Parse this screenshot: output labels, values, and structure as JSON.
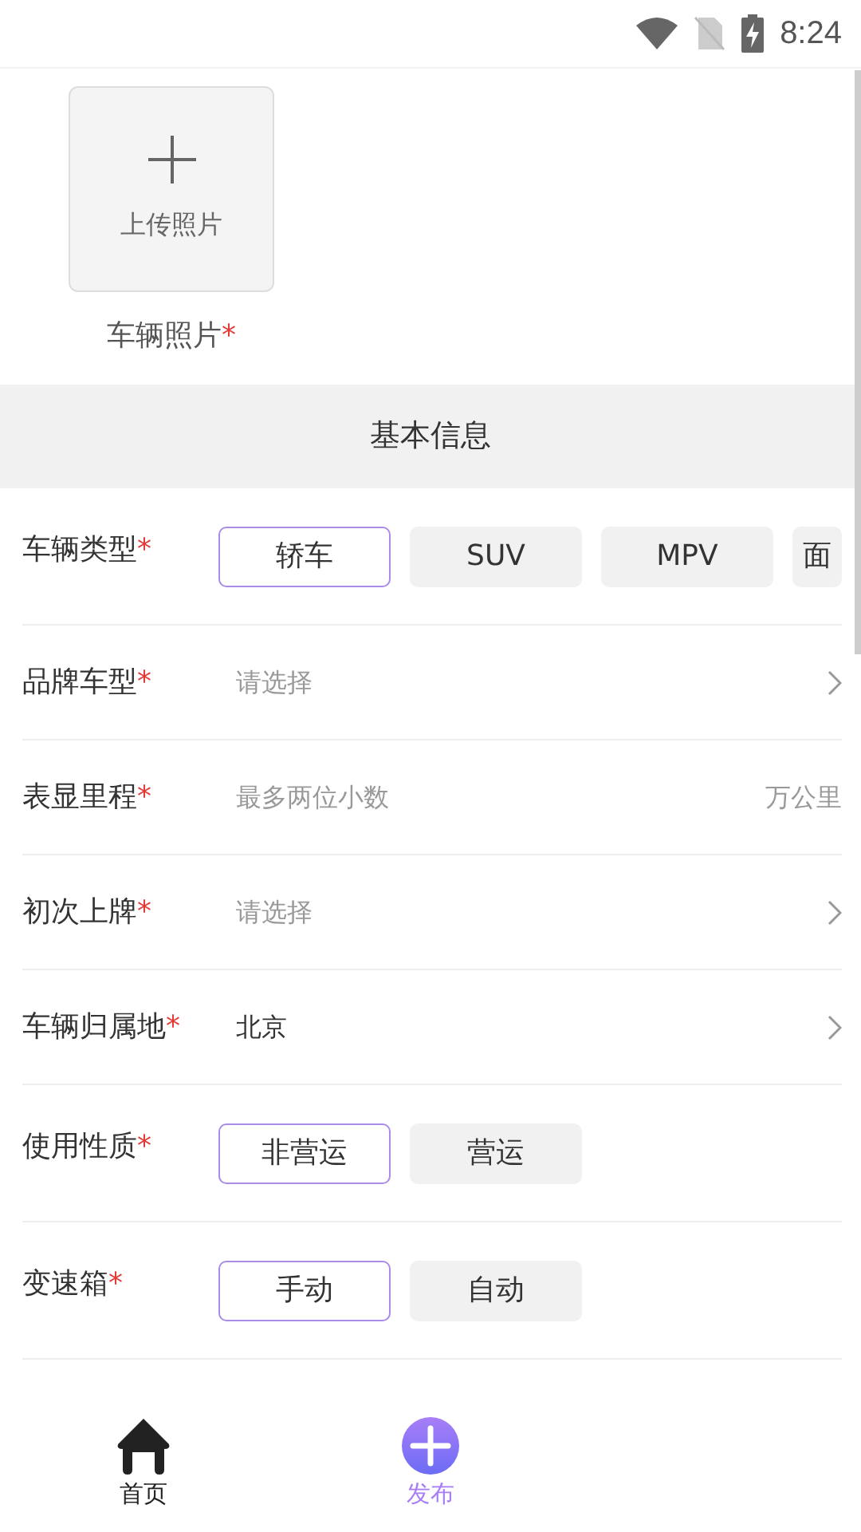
{
  "status_bar": {
    "time": "8:24"
  },
  "photo_upload": {
    "button_label": "上传照片",
    "caption": "车辆照片",
    "required_mark": "*"
  },
  "section_header": {
    "title": "基本信息"
  },
  "fields": [
    {
      "kind": "chips",
      "label": "车辆类型",
      "required_mark": "*",
      "options": [
        {
          "label": "轿车",
          "selected": true
        },
        {
          "label": "SUV",
          "selected": false
        },
        {
          "label": "MPV",
          "selected": false
        },
        {
          "label": "面",
          "selected": false
        }
      ]
    },
    {
      "kind": "select",
      "label": "品牌车型",
      "required_mark": "*",
      "placeholder": "请选择"
    },
    {
      "kind": "input",
      "label": "表显里程",
      "required_mark": "*",
      "placeholder": "最多两位小数",
      "unit": "万公里"
    },
    {
      "kind": "select",
      "label": "初次上牌",
      "required_mark": "*",
      "placeholder": "请选择"
    },
    {
      "kind": "select",
      "label": "车辆归属地",
      "required_mark": "*",
      "value": "北京"
    },
    {
      "kind": "chips",
      "label": "使用性质",
      "required_mark": "*",
      "options": [
        {
          "label": "非营运",
          "selected": true
        },
        {
          "label": "营运",
          "selected": false
        }
      ]
    },
    {
      "kind": "chips",
      "label": "变速箱",
      "required_mark": "*",
      "options": [
        {
          "label": "手动",
          "selected": true
        },
        {
          "label": "自动",
          "selected": false
        }
      ]
    }
  ],
  "bottom_nav": [
    {
      "kind": "home",
      "label": "首页",
      "selected": false
    },
    {
      "kind": "publish",
      "label": "发布",
      "selected": true
    }
  ]
}
